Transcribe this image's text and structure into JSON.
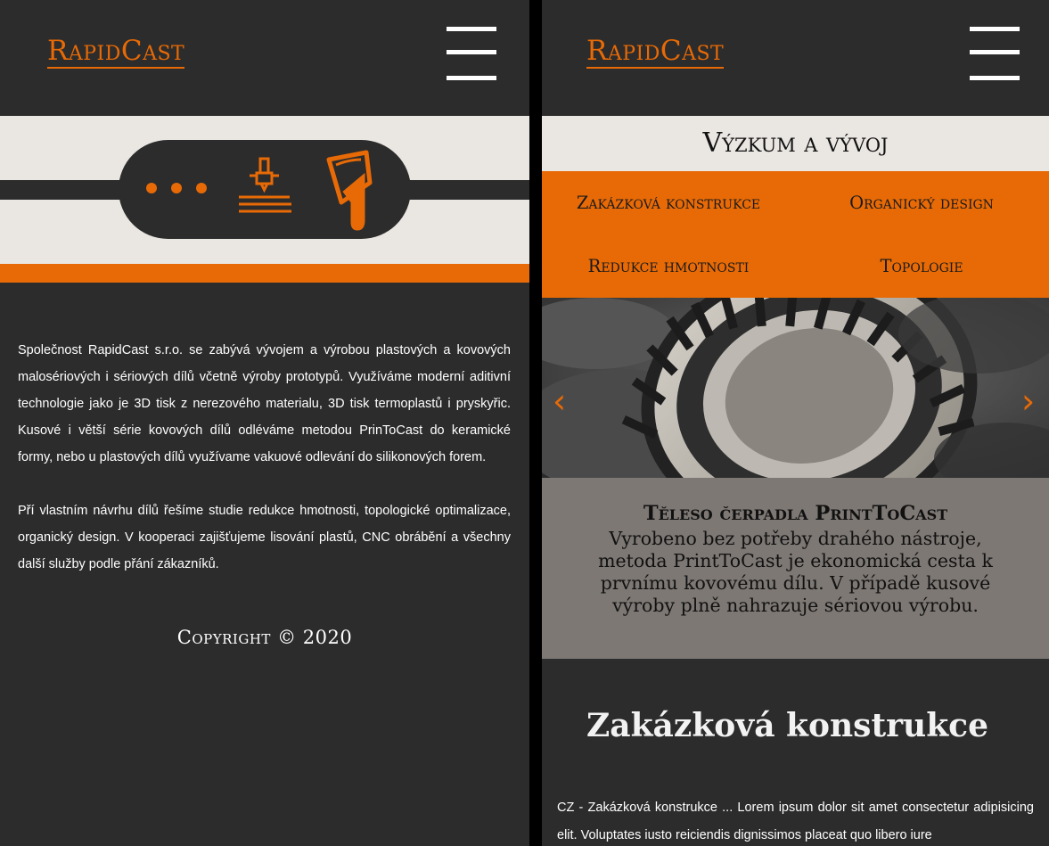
{
  "brand": {
    "logo": "RapidCast",
    "accent_color": "#e86a06",
    "dark_color": "#2c2c2c",
    "light_color": "#eae7e3"
  },
  "left": {
    "hero": {
      "icons": [
        "three-dots-icon",
        "3d-printer-icon",
        "casting-ladle-icon"
      ]
    },
    "about": {
      "paragraph1": "Společnost RapidCast s.r.o. se zabývá vývojem a výrobou plastových a kovových malosériových i sériových dílů včetně výroby prototypů. Využíváme moderní aditivní technologie jako je 3D tisk z nerezového materialu, 3D tisk termoplastů i pryskyřic. Kusové i větší série kovových dílů odléváme metodou PrinToCast do keramické formy, nebo u plastových dílů využívame vakuové odlevání do silikonových forem.",
      "paragraph2": "Pří vlastním návrhu dílů řešíme studie redukce hmotnosti, topologické optimalizace, organický design. V kooperaci zajišťujeme lisování plastů, CNC obrábění a všechny další služby podle přání zákazníků."
    },
    "copyright": "Copyright © 2020"
  },
  "right": {
    "section_title": "Výzkum a vývoj",
    "menu": [
      {
        "label": "Zakázková konstrukce"
      },
      {
        "label": "Organický design"
      },
      {
        "label": "Redukce hmotnosti"
      },
      {
        "label": "Topologie"
      }
    ],
    "slider": {
      "prev": "‹",
      "next": "›"
    },
    "caption": {
      "title": "Těleso čerpadla PrintToCast",
      "text": "Vyrobeno bez potřeby drahého nástroje, metoda PrintToCast je ekonomická cesta k prvnímu kovovému dílu. V případě kusové výroby plně nahrazuje sériovou výrobu."
    },
    "content": {
      "heading": "Zakázková konstrukce",
      "text": "CZ - Zakázková konstrukce ... Lorem ipsum dolor sit amet consectetur adipisicing elit. Voluptates iusto reiciendis dignissimos placeat quo libero iure"
    }
  }
}
